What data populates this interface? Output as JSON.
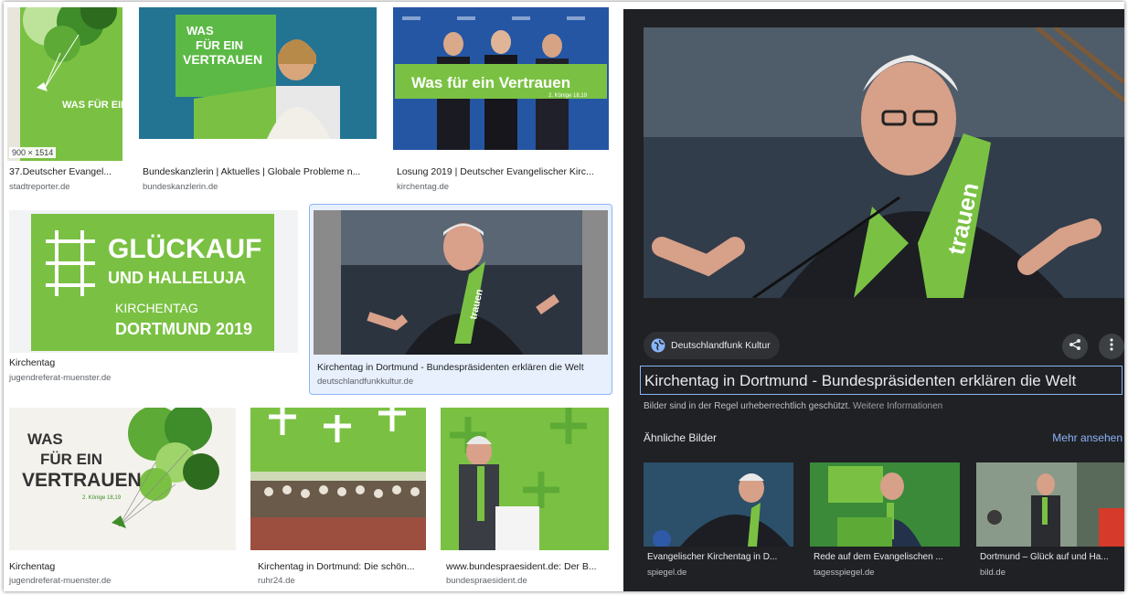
{
  "results": [
    {
      "caption": "37.Deutscher Evangel...",
      "source": "stadtreporter.de",
      "dimensions": "900 × 1514"
    },
    {
      "caption": "Bundeskanzlerin | Aktuelles | Globale Probleme n...",
      "source": "bundeskanzlerin.de"
    },
    {
      "caption": "Losung 2019 | Deutscher Evangelischer Kirc...",
      "source": "kirchentag.de"
    },
    {
      "caption": "Kirchentag",
      "source": "jugendreferat-muenster.de"
    },
    {
      "caption": "Kirchentag in Dortmund - Bundespräsidenten erklären die Welt",
      "source": "deutschlandfunkkultur.de"
    },
    {
      "caption": "Kirchentag",
      "source": "jugendreferat-muenster.de"
    },
    {
      "caption": "Kirchentag in Dortmund: Die schön...",
      "source": "ruhr24.de"
    },
    {
      "caption": "www.bundespraesident.de: Der B...",
      "source": "bundespraesident.de"
    }
  ],
  "image_text": {
    "poster_title": "WAS FÜR EIN VERTRAUEN",
    "banner": "Was für ein Vertrauen",
    "banner_small": "2. Könige 18,19",
    "glueckauf_line1": "GLÜCKAUF",
    "glueckauf_line2": "UND HALLELUJA",
    "glueckauf_line3": "KIRCHENTAG",
    "glueckauf_line4": "DORTMUND 2019",
    "scarf": "trauen",
    "stage_slogan_1": "WAS",
    "stage_slogan_2": "FÜR EIN",
    "stage_slogan_3": "VERTRAUEN"
  },
  "panel": {
    "close_icon": "×",
    "source_chip": "Deutschlandfunk Kultur",
    "title": "Kirchentag in Dortmund - Bundespräsidenten erklären die Welt",
    "copyright_text": "Bilder sind in der Regel urheberrechtlich geschützt.",
    "copyright_link": "Weitere Informationen",
    "similar_heading": "Ähnliche Bilder",
    "more_link": "Mehr ansehen",
    "similar": [
      {
        "caption": "Evangelischer Kirchentag in D...",
        "source": "spiegel.de"
      },
      {
        "caption": "Rede auf dem Evangelischen ...",
        "source": "tagesspiegel.de"
      },
      {
        "caption": "Dortmund – Glück auf und Ha...",
        "source": "bild.de"
      }
    ]
  },
  "colors": {
    "kirchentag_green": "#7ac143",
    "panel_bg": "#202124",
    "link_blue": "#8ab4f8"
  }
}
